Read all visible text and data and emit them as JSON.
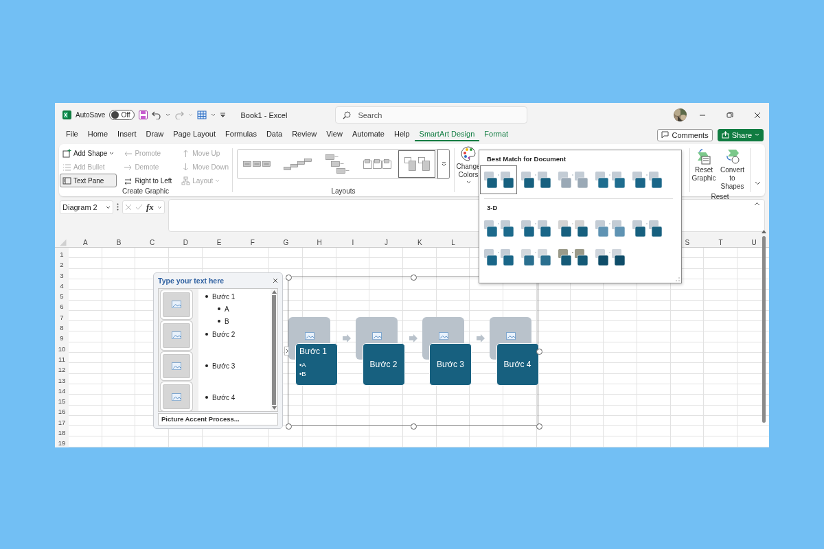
{
  "window": {
    "title": "Book1  -  Excel"
  },
  "autosave": {
    "label": "AutoSave",
    "toggle_text": "Off",
    "on": false
  },
  "search": {
    "placeholder": "Search"
  },
  "menu_tabs": [
    {
      "label": "File",
      "selected": false
    },
    {
      "label": "Home",
      "selected": false
    },
    {
      "label": "Insert",
      "selected": false
    },
    {
      "label": "Draw",
      "selected": false
    },
    {
      "label": "Page Layout",
      "selected": false
    },
    {
      "label": "Formulas",
      "selected": false
    },
    {
      "label": "Data",
      "selected": false
    },
    {
      "label": "Review",
      "selected": false
    },
    {
      "label": "View",
      "selected": false
    },
    {
      "label": "Automate",
      "selected": false
    },
    {
      "label": "Help",
      "selected": false
    },
    {
      "label": "SmartArt Design",
      "selected": true
    },
    {
      "label": "Format",
      "selected": false
    }
  ],
  "account_buttons": [
    {
      "label": "Comments",
      "kind": "outline"
    },
    {
      "label": "Share",
      "kind": "primary"
    }
  ],
  "ribbon": {
    "create_graphic": {
      "label": "Create Graphic",
      "columns": [
        [
          {
            "label": "Add Shape",
            "disabled": false,
            "on": false,
            "dropdown": true
          },
          {
            "label": "Add Bullet",
            "disabled": true,
            "on": false,
            "dropdown": false
          },
          {
            "label": "Text Pane",
            "disabled": false,
            "on": true,
            "dropdown": false
          }
        ],
        [
          {
            "label": "Promote",
            "disabled": true,
            "on": false,
            "dropdown": false
          },
          {
            "label": "Demote",
            "disabled": true,
            "on": false,
            "dropdown": false
          },
          {
            "label": "Right to Left",
            "disabled": false,
            "on": false,
            "dropdown": false
          }
        ],
        [
          {
            "label": "Move Up",
            "disabled": true,
            "on": false,
            "dropdown": false
          },
          {
            "label": "Move Down",
            "disabled": true,
            "on": false,
            "dropdown": false
          },
          {
            "label": "Layout",
            "disabled": true,
            "on": false,
            "dropdown": true
          }
        ]
      ]
    },
    "layouts": {
      "label": "Layouts",
      "items": [
        {
          "selected": false
        },
        {
          "selected": false
        },
        {
          "selected": false
        },
        {
          "selected": false
        },
        {
          "selected": true
        }
      ]
    },
    "change_colors": {
      "label": "Change Colors"
    },
    "reset": {
      "label": "Reset",
      "buttons": [
        "Reset Graphic",
        "Convert to Shapes"
      ]
    }
  },
  "formula_bar": {
    "name_box": "Diagram 2",
    "function_button": "fx"
  },
  "sheet": {
    "column_groups": [
      [
        "A",
        "B",
        "C",
        "D",
        "E",
        "F",
        "G",
        "H",
        "I",
        "J",
        "K",
        "L"
      ],
      [
        "S",
        "T",
        "U"
      ]
    ],
    "rows": [
      "1",
      "2",
      "3",
      "4",
      "5",
      "6",
      "7",
      "8",
      "9",
      "10",
      "11",
      "12",
      "13",
      "14",
      "15",
      "16",
      "17",
      "18",
      "19"
    ]
  },
  "text_pane": {
    "title": "Type your text here",
    "items": [
      {
        "text": "Bước 1",
        "children": [
          {
            "text": "A"
          },
          {
            "text": "B"
          }
        ]
      },
      {
        "text": "Bước 2"
      },
      {
        "text": "Bước 3"
      },
      {
        "text": "Bước 4"
      }
    ],
    "footer": "Picture Accent Process..."
  },
  "diagram": {
    "steps": [
      {
        "title": "Bước 1",
        "bullets": [
          "•A",
          "•B"
        ]
      },
      {
        "title": "Bước 2"
      },
      {
        "title": "Bước 3"
      },
      {
        "title": "Bước 4"
      }
    ]
  },
  "style_gallery": {
    "sections": [
      {
        "title": "Best Match for Document",
        "items": [
          {
            "selected": true
          },
          {
            "selected": false
          },
          {
            "selected": false
          },
          {
            "selected": false
          },
          {
            "selected": false
          }
        ]
      },
      {
        "title": "3-D",
        "items": [
          {
            "selected": false
          },
          {
            "selected": false
          },
          {
            "selected": false
          },
          {
            "selected": false
          },
          {
            "selected": false
          },
          {
            "selected": false
          },
          {
            "selected": false
          },
          {
            "selected": false
          },
          {
            "selected": false
          }
        ]
      }
    ]
  }
}
